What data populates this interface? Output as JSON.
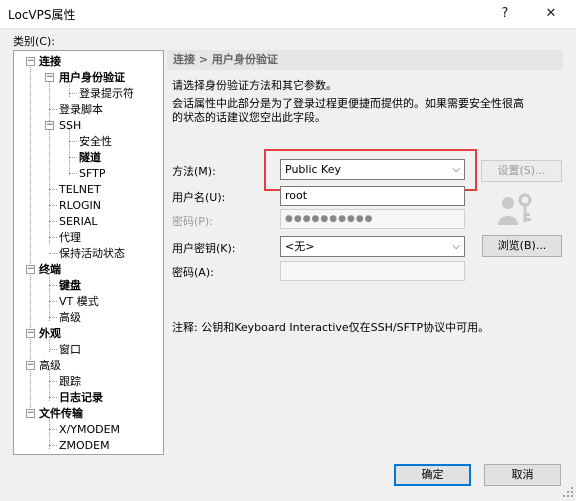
{
  "window": {
    "title": "LocVPS属性",
    "help": "?",
    "close": "✕"
  },
  "category_label": "类别(C):",
  "tree": {
    "connection": "连接",
    "user_auth": "用户身份验证",
    "login_prompt": "登录提示符",
    "login_script": "登录脚本",
    "ssh": "SSH",
    "security": "安全性",
    "tunnel": "隧道",
    "sftp": "SFTP",
    "telnet": "TELNET",
    "rlogin": "RLOGIN",
    "serial": "SERIAL",
    "proxy": "代理",
    "keepalive": "保持活动状态",
    "terminal": "终端",
    "keyboard": "键盘",
    "vt_mode": "VT 模式",
    "term_advanced": "高级",
    "appearance": "外观",
    "window": "窗口",
    "advanced": "高级",
    "trace": "跟踪",
    "logging": "日志记录",
    "file_transfer": "文件传输",
    "xymodem": "X/YMODEM",
    "zmodem": "ZMODEM"
  },
  "panel": {
    "header": "连接 > 用户身份验证",
    "desc1": "请选择身份验证方法和其它参数。",
    "desc2": "会话属性中此部分是为了登录过程更便捷而提供的。如果需要安全性很高",
    "desc3": "的状态的话建议您空出此字段。",
    "method_label": "方法(M):",
    "method_value": "Public Key",
    "settings_button": "设置(S)...",
    "username_label": "用户名(U):",
    "username_value": "root",
    "password_label": "密码(P):",
    "password_value": "●●●●●●●●●●",
    "userkey_label": "用户密钥(K):",
    "userkey_value": "<无>",
    "browse_button": "浏览(B)...",
    "passphrase_label": "密码(A):",
    "passphrase_value": "",
    "note": "注释: 公钥和Keyboard Interactive仅在SSH/SFTP协议中可用。"
  },
  "footer": {
    "ok": "确定",
    "cancel": "取消"
  },
  "colors": {
    "highlight_box": "#e04040",
    "default_button_border": "#0078d7"
  }
}
